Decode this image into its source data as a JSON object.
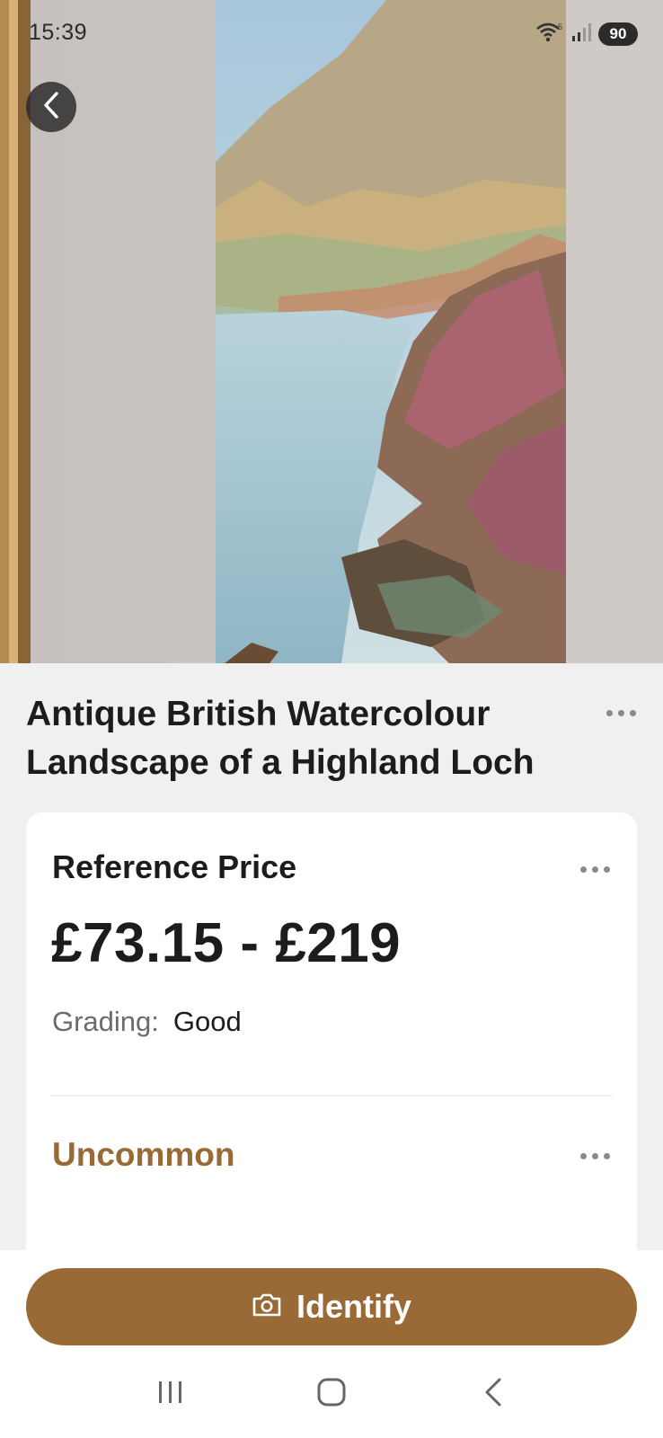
{
  "status_bar": {
    "time": "15:39",
    "battery": "90",
    "icons": [
      "wifi-icon",
      "signal-icon",
      "battery-icon"
    ]
  },
  "header": {
    "back_icon": "chevron-left-icon"
  },
  "item": {
    "title": "Antique British Watercolour Landscape of a Highland Loch",
    "more_icon": "more-dots-icon"
  },
  "price_card": {
    "label": "Reference Price",
    "price_range": "£73.15 - £219",
    "grading_key": "Grading:",
    "grading_value": "Good",
    "rarity": "Uncommon"
  },
  "actions": {
    "identify_label": "Identify",
    "identify_icon": "camera-icon"
  },
  "nav": {
    "items": [
      "recent-apps-icon",
      "home-icon",
      "back-icon"
    ]
  },
  "colors": {
    "accent": "#9a6a36",
    "background": "#f0f0f0",
    "card": "#ffffff"
  }
}
